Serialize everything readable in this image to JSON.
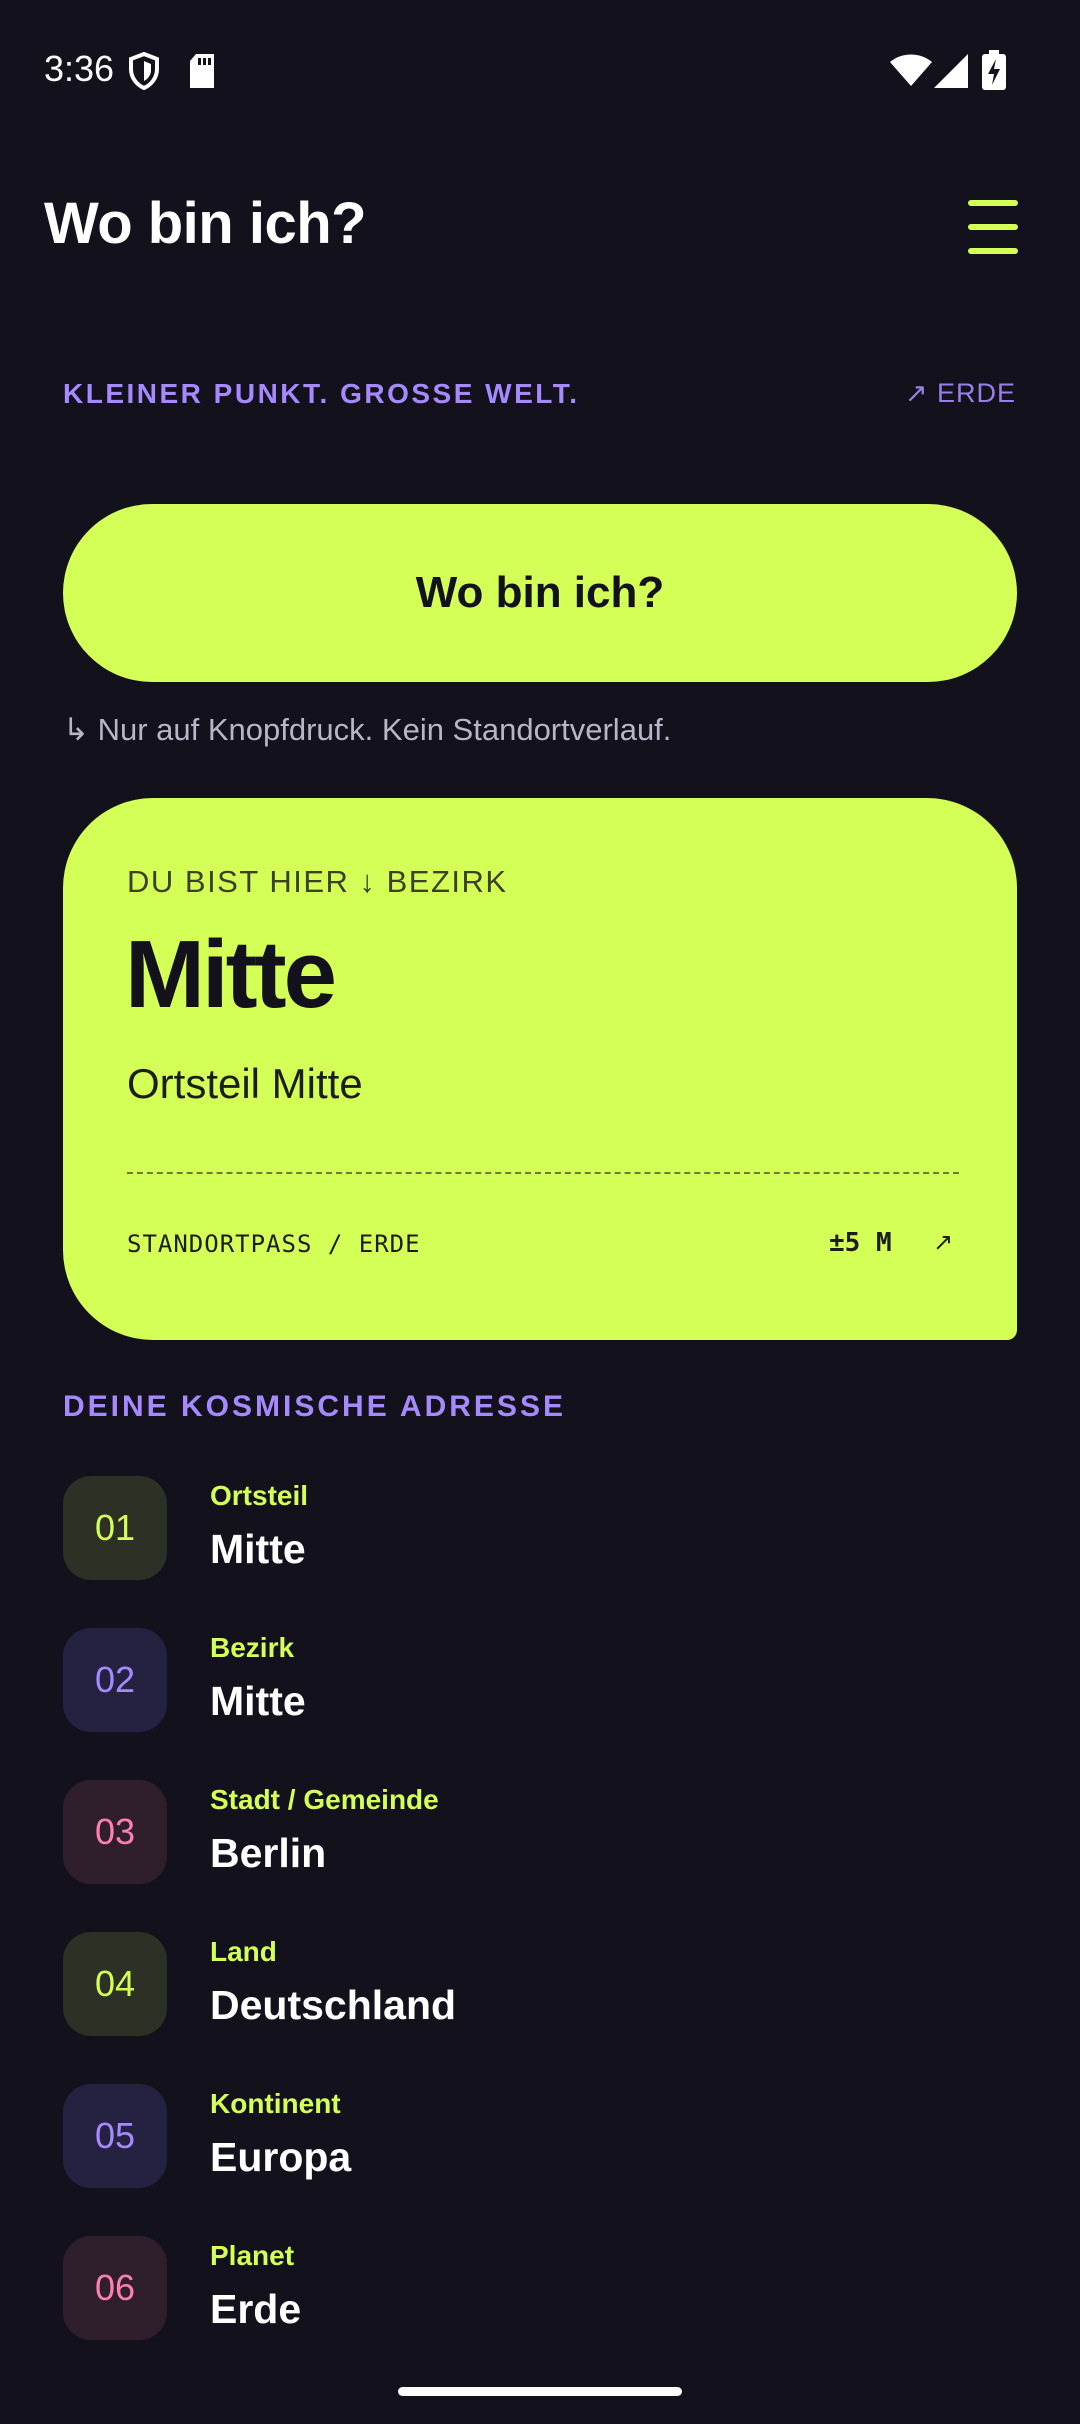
{
  "status_bar": {
    "time": "3:36",
    "icons": [
      "shield-icon",
      "sd-card-icon",
      "wifi-icon",
      "signal-icon",
      "battery-charging-icon"
    ]
  },
  "app_bar": {
    "title": "Wo bin ich?",
    "menu_icon": "hamburger-menu-icon"
  },
  "tagline": {
    "text": "KLEINER PUNKT. GROSSE WELT.",
    "link": "↗ ERDE"
  },
  "main_button": {
    "label": "Wo bin ich?"
  },
  "privacy_note": "↳ Nur auf Knopfdruck. Kein Standortverlauf.",
  "location_card": {
    "kicker": "DU BIST HIER ↓ BEZIRK",
    "place": "Mitte",
    "subtitle": "Ortsteil Mitte",
    "footer_left": "STANDORTPASS / ERDE",
    "accuracy": "±5 M",
    "arrow": "↗"
  },
  "cosmic_address": {
    "title": "DEINE KOSMISCHE ADRESSE",
    "items": [
      {
        "number": "01",
        "label": "Ortsteil",
        "value": "Mitte"
      },
      {
        "number": "02",
        "label": "Bezirk",
        "value": "Mitte"
      },
      {
        "number": "03",
        "label": "Stadt / Gemeinde",
        "value": "Berlin"
      },
      {
        "number": "04",
        "label": "Land",
        "value": "Deutschland"
      },
      {
        "number": "05",
        "label": "Kontinent",
        "value": "Europa"
      },
      {
        "number": "06",
        "label": "Planet",
        "value": "Erde"
      }
    ]
  },
  "colors": {
    "background": "#12111c",
    "accent_lime": "#d4ff57",
    "accent_purple": "#a689ff",
    "accent_pink": "#ff7fb4"
  }
}
